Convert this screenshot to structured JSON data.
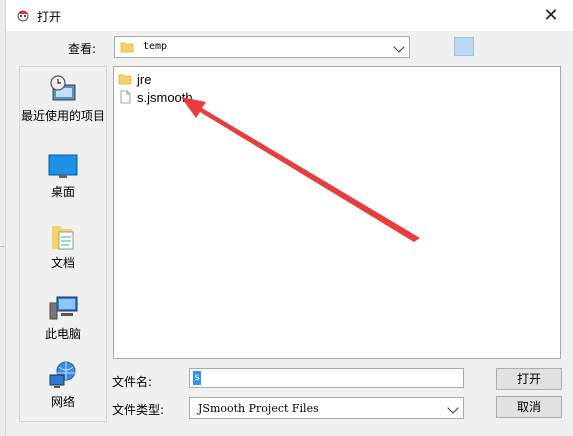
{
  "window": {
    "title": "打开",
    "close_symbol": "✕"
  },
  "lookin": {
    "label": "查看:",
    "value": "temp"
  },
  "places": [
    {
      "label": "最近使用的项目",
      "icon": "recent-items-icon"
    },
    {
      "label": "桌面",
      "icon": "desktop-icon"
    },
    {
      "label": "文档",
      "icon": "documents-icon"
    },
    {
      "label": "此电脑",
      "icon": "this-pc-icon"
    },
    {
      "label": "网络",
      "icon": "network-icon"
    }
  ],
  "files": [
    {
      "name": "jre",
      "type": "folder"
    },
    {
      "name": "s.jsmooth",
      "type": "file"
    }
  ],
  "filename": {
    "label": "文件名:",
    "value": "s"
  },
  "filetype": {
    "label": "文件类型:",
    "value": "JSmooth Project Files"
  },
  "buttons": {
    "open": "打开",
    "cancel": "取消"
  },
  "colors": {
    "annotation_arrow": "#e83d3d",
    "selection": "#3390ff",
    "folder": "#f7d06a"
  }
}
